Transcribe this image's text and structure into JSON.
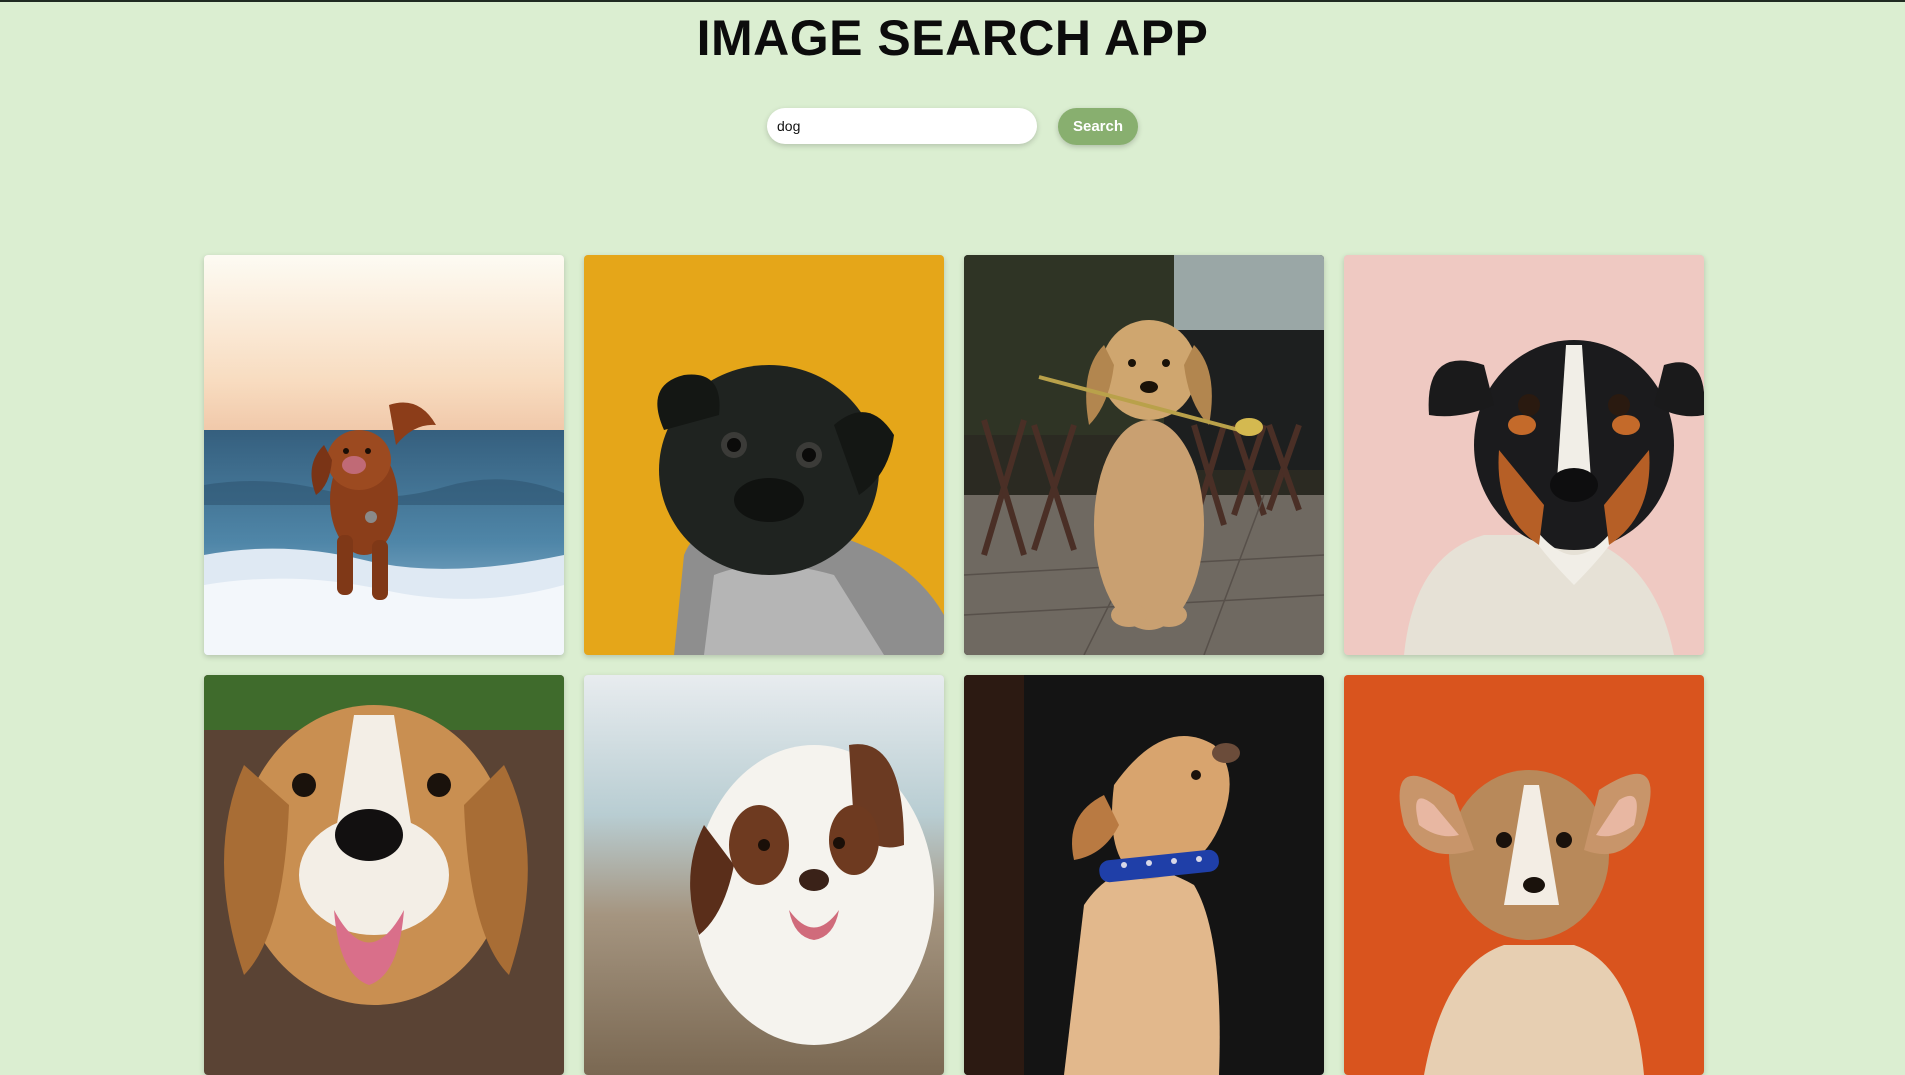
{
  "app": {
    "title": "IMAGE SEARCH APP"
  },
  "search": {
    "value": "dog",
    "button_label": "Search"
  },
  "results": [
    {
      "name": "dog-image-1",
      "subject": "brown retriever running on beach"
    },
    {
      "name": "dog-image-2",
      "subject": "black pug in sweater on yellow background"
    },
    {
      "name": "dog-image-3",
      "subject": "golden retriever holding flower"
    },
    {
      "name": "dog-image-4",
      "subject": "jack russell terrier on pink background"
    },
    {
      "name": "dog-image-5",
      "subject": "beagle close-up"
    },
    {
      "name": "dog-image-6",
      "subject": "australian shepherd at beach"
    },
    {
      "name": "dog-image-7",
      "subject": "labrador puppy with blue collar"
    },
    {
      "name": "dog-image-8",
      "subject": "corgi puppy on orange background"
    }
  ],
  "colors": {
    "page_background": "#dbeed1",
    "button_background": "#88af6f",
    "button_text": "#ffffff"
  }
}
